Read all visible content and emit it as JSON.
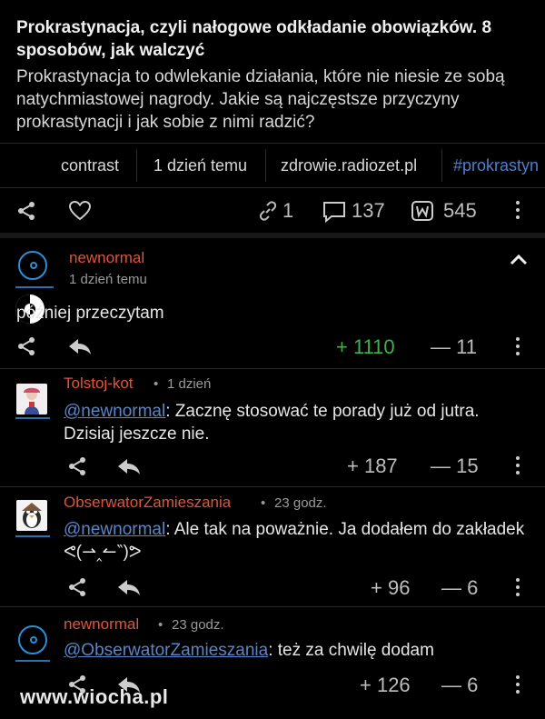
{
  "article": {
    "title": "Prokrastynacja, czyli nałogowe odkładanie obowiązków. 8 sposobów, jak walczyć",
    "description": "Prokrastynacja to odwlekanie działania, które nie niesie ze sobą natychmiastowej nagrody. Jakie są najczęstsze przyczyny prokrastynacji i jak sobie z nimi radzić?",
    "author": "contrast",
    "time": "1 dzień temu",
    "source": "zdrowie.radiozet.pl",
    "tag": "#prokrastyn",
    "links": "1",
    "comments": "137",
    "votes": "545"
  },
  "comments": [
    {
      "user": "newnormal",
      "time": "1 dzień temu",
      "text": "później przeczytam",
      "plus": "+ 1110",
      "minus": "— 11"
    },
    {
      "user": "Tolstoj-kot",
      "time": "1 dzień",
      "mention": "@newnormal",
      "text": ": Zacznę stosować te porady już od jutra. Dzisiaj jeszcze nie.",
      "plus": "+ 187",
      "minus": "— 15"
    },
    {
      "user": "ObserwatorZamieszania",
      "time": "23 godz.",
      "mention": "@newnormal",
      "text": ": Ale tak na poważnie. Ja dodałem do zakładek ᕙ(⇀‸↼‶)ᕗ",
      "plus": "+ 96",
      "minus": "— 6"
    },
    {
      "user": "newnormal",
      "time": "23 godz.",
      "mention": "@ObserwatorZamieszania",
      "text": ": też za chwilę dodam",
      "plus": "+ 126",
      "minus": "— 6"
    }
  ],
  "watermark": "www.wiocha.pl",
  "icons": [
    "share-icon",
    "heart-icon",
    "link-icon",
    "comment-icon",
    "vote-icon",
    "more-icon",
    "reply-icon",
    "collapse-chevron-icon",
    "power-icon"
  ],
  "colors": {
    "background": "#000000",
    "username": "#c8392b",
    "upvote_green": "#3fb24a",
    "mention": "#5b86c6",
    "avatar_blue": "#2a8fd6"
  }
}
